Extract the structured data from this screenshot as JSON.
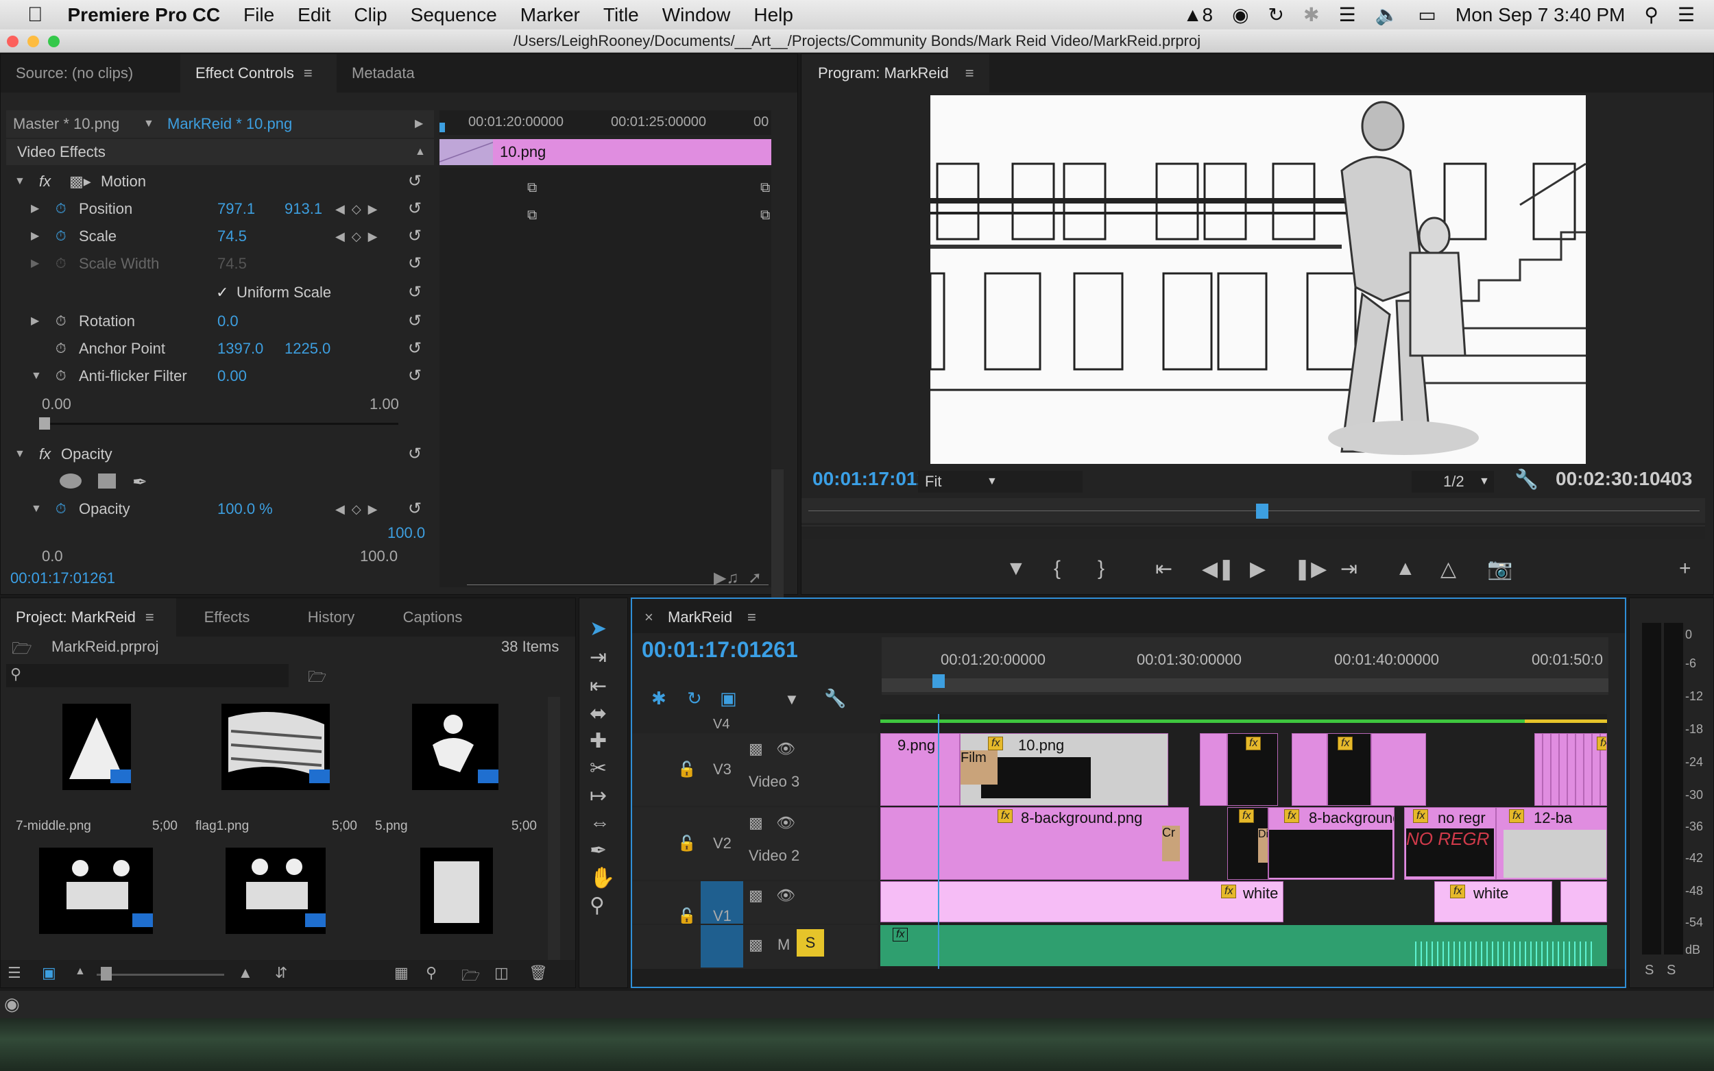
{
  "menubar": {
    "app_name": "Premiere Pro CC",
    "items": [
      "File",
      "Edit",
      "Clip",
      "Sequence",
      "Marker",
      "Title",
      "Window",
      "Help"
    ],
    "adobe_badge": "8",
    "datetime": "Mon Sep 7  3:40 PM"
  },
  "window": {
    "title": "/Users/LeighRooney/Documents/__Art__/Projects/Community Bonds/Mark Reid Video/MarkReid.prproj"
  },
  "source_panel": {
    "tabs": [
      "Source: (no clips)",
      "Effect Controls",
      "Metadata"
    ],
    "active_tab": "Effect Controls",
    "master_clip": "Master * 10.png",
    "sequence_clip": "MarkReid * 10.png",
    "ruler_times": [
      "00:01:20:00000",
      "00:01:25:00000",
      "00"
    ],
    "clip_bar_label": "10.png",
    "section_video_effects": "Video Effects",
    "motion": "Motion",
    "position": {
      "label": "Position",
      "x": "797.1",
      "y": "913.1"
    },
    "scale": {
      "label": "Scale",
      "value": "74.5"
    },
    "scale_width": {
      "label": "Scale Width",
      "value": "74.5"
    },
    "uniform_scale": "Uniform Scale",
    "rotation": {
      "label": "Rotation",
      "value": "0.0"
    },
    "anchor": {
      "label": "Anchor Point",
      "x": "1397.0",
      "y": "1225.0"
    },
    "antiflicker": {
      "label": "Anti-flicker Filter",
      "value": "0.00"
    },
    "slider_min": "0.00",
    "slider_max": "1.00",
    "opacity_section": "Opacity",
    "opacity": {
      "label": "Opacity",
      "value": "100.0 %"
    },
    "graph_max": "100.0",
    "graph_min_left": "0.0",
    "graph_min_right": "100.0",
    "timecode": "00:01:17:01261"
  },
  "program_monitor": {
    "title": "Program: MarkReid",
    "timecode": "00:01:17:01261",
    "fit": "Fit",
    "resolution": "1/2",
    "duration": "00:02:30:10403",
    "playhead_fraction": 0.51
  },
  "project_panel": {
    "tabs": [
      "Project: MarkReid",
      "Effects",
      "History",
      "Captions"
    ],
    "file": "MarkReid.prproj",
    "count": "38 Items",
    "items": [
      {
        "name": "7-middle.png",
        "duration": "5;00"
      },
      {
        "name": "flag1.png",
        "duration": "5;00"
      },
      {
        "name": "5.png",
        "duration": "5;00"
      },
      {
        "name": "",
        "duration": ""
      },
      {
        "name": "",
        "duration": ""
      },
      {
        "name": "",
        "duration": ""
      }
    ]
  },
  "timeline": {
    "title": "MarkReid",
    "timecode": "00:01:17:01261",
    "ruler": [
      "00:01:20:00000",
      "00:01:30:00000",
      "00:01:40:00000",
      "00:01:50:0"
    ],
    "tracks": {
      "v4": "V4",
      "v3": {
        "id": "V3",
        "name": "Video 3"
      },
      "v2": {
        "id": "V2",
        "name": "Video 2"
      },
      "v1": {
        "id": "V1"
      },
      "a1": {
        "m": "M",
        "s": "S"
      }
    },
    "clips": {
      "v3_a": "9.png",
      "v3_b": "10.png",
      "v3_film": "Film",
      "v2_a": "8-background.png",
      "v2_cr": "Cr",
      "v2_b": "8-background",
      "v2_c": "no regr",
      "v2_d": "12-ba",
      "v2_di": "Di",
      "v2_text": "NO REGR",
      "v1_a": "white",
      "v1_b": "white"
    }
  },
  "meter": {
    "labels": [
      "0",
      "-6",
      "-12",
      "-18",
      "-24",
      "-30",
      "-36",
      "-42",
      "-48",
      "-54",
      "dB"
    ],
    "solo": [
      "S",
      "S"
    ]
  }
}
